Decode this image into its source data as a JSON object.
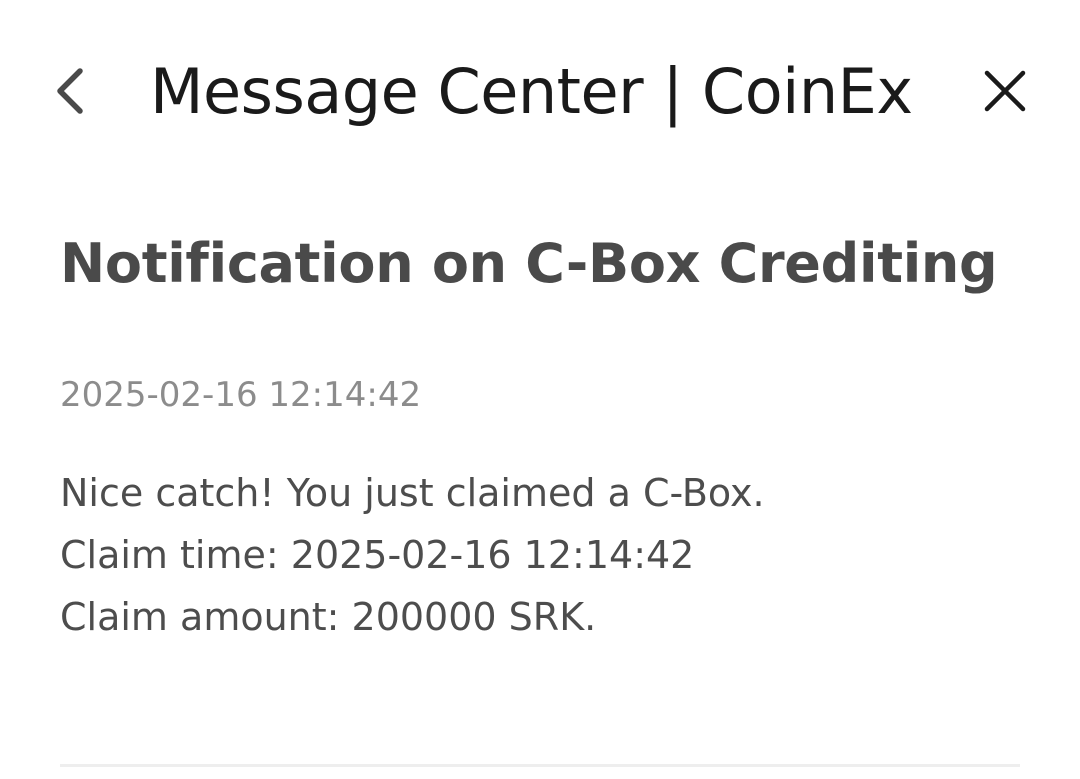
{
  "header": {
    "title": "Message Center | CoinEx",
    "back_icon": "chevron-left-icon",
    "close_icon": "close-icon"
  },
  "message": {
    "title": "Notification on C-Box Crediting",
    "timestamp": "2025-02-16 12:14:42",
    "lines": [
      "Nice catch! You just claimed a C-Box.",
      "Claim time: 2025-02-16 12:14:42",
      "Claim amount: 200000 SRK."
    ]
  },
  "colors": {
    "title": "#1a1a1a",
    "heading": "#4a4a4a",
    "timestamp": "#8c8c8c",
    "body": "#4d4d4d",
    "divider": "#eeeeee"
  }
}
